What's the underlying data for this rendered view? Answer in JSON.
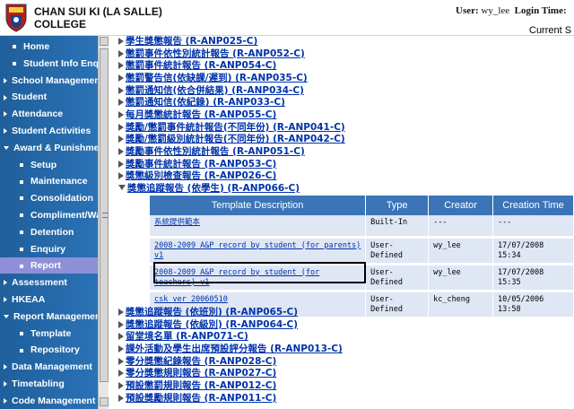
{
  "header": {
    "school_line1": "CHAN SUI KI (LA SALLE)",
    "school_line2": "COLLEGE",
    "user_label": "User:",
    "user_value": "wy_lee",
    "login_label": "Login Time:",
    "current": "Current S"
  },
  "sidebar": {
    "items": [
      {
        "label": "Home",
        "marker": "square"
      },
      {
        "label": "Student Info Enq",
        "marker": "square"
      },
      {
        "label": "School Managemen",
        "marker": "arrow"
      },
      {
        "label": "Student",
        "marker": "arrow"
      },
      {
        "label": "Attendance",
        "marker": "arrow"
      },
      {
        "label": "Student Activities",
        "marker": "arrow"
      },
      {
        "label": "Award & Punishme",
        "marker": "arrow-down"
      },
      {
        "label": "Setup",
        "marker": "square"
      },
      {
        "label": "Maintenance",
        "marker": "square"
      },
      {
        "label": "Consolidation",
        "marker": "square"
      },
      {
        "label": "Compliment/Wa",
        "marker": "square"
      },
      {
        "label": "Detention",
        "marker": "square"
      },
      {
        "label": "Enquiry",
        "marker": "square"
      },
      {
        "label": "Report",
        "marker": "square",
        "active": true
      },
      {
        "label": "Assessment",
        "marker": "arrow"
      },
      {
        "label": "HKEAA",
        "marker": "arrow"
      },
      {
        "label": "Report Managemen",
        "marker": "arrow-down"
      },
      {
        "label": "Template",
        "marker": "square"
      },
      {
        "label": "Repository",
        "marker": "square"
      },
      {
        "label": "Data Management",
        "marker": "arrow"
      },
      {
        "label": "Timetabling",
        "marker": "arrow"
      },
      {
        "label": "Code Management",
        "marker": "arrow"
      }
    ]
  },
  "reports_top": [
    {
      "text": "學生獎懲報告 (R-ANP025-C)"
    },
    {
      "text": "懲罰事件依性別統計報告 (R-ANP052-C)"
    },
    {
      "text": "懲罰事件統計報告 (R-ANP054-C)"
    },
    {
      "text": "懲罰警告信(依缺課/遲到) (R-ANP035-C)"
    },
    {
      "text": "懲罰通知信(依合併結果) (R-ANP034-C)"
    },
    {
      "text": "懲罰通知信(依紀錄) (R-ANP033-C)"
    },
    {
      "text": "每月獎懲統計報告 (R-ANP055-C)"
    },
    {
      "text": "獎勵/懲罰事件統計報告(不同年份) (R-ANP041-C)"
    },
    {
      "text": "獎勵/懲罰級別統計報告(不同年份) (R-ANP042-C)"
    },
    {
      "text": "獎勵事件依性別統計報告 (R-ANP051-C)"
    },
    {
      "text": "獎勵事件統計報告 (R-ANP053-C)"
    },
    {
      "text": "獎懲級別檢查報告 (R-ANP026-C)"
    },
    {
      "text": "獎懲追蹤報告 (依學生) (R-ANP066-C)",
      "expanded": true
    }
  ],
  "table": {
    "headers": [
      "Template Description",
      "Type",
      "Creator",
      "Creation Time"
    ],
    "rows": [
      {
        "desc": "系統提供範本",
        "desc2": "",
        "type": "Built-In",
        "type2": "",
        "creator": "---",
        "time": "---",
        "time2": ""
      },
      {
        "desc": "2008-2009 A&P record by student (for parents)",
        "desc2": "v1",
        "type": "User-",
        "type2": "Defined",
        "creator": "wy_lee",
        "time": "17/07/2008",
        "time2": "15:34"
      },
      {
        "desc": "2008-2009 A&P record by student (for",
        "desc2": "teachers) v1",
        "type": "User-",
        "type2": "Defined",
        "creator": "wy_lee",
        "time": "17/07/2008",
        "time2": "15:35"
      },
      {
        "desc": "csk ver 20060510",
        "desc2": "",
        "type": "User-",
        "type2": "Defined",
        "creator": "kc_cheng",
        "time": "10/05/2006",
        "time2": "13:58"
      }
    ]
  },
  "reports_bottom": [
    {
      "text": "獎懲追蹤報告 (依班別) (R-ANP065-C)"
    },
    {
      "text": "獎懲追蹤報告 (依級別) (R-ANP064-C)"
    },
    {
      "text": "留堂境名單 (R-ANP071-C)"
    },
    {
      "text": "課外活動及學生出席預設評分報告 (R-ANP013-C)"
    },
    {
      "text": "零分獎懲紀錄報告 (R-ANP028-C)"
    },
    {
      "text": "零分獎懲規則報告 (R-ANP027-C)"
    },
    {
      "text": "預設懲罰規則報告 (R-ANP012-C)"
    },
    {
      "text": "預設獎勵規則報告 (R-ANP011-C)"
    }
  ]
}
